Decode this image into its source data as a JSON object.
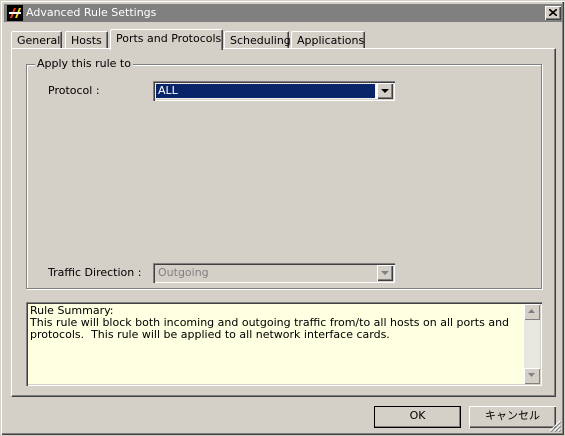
{
  "window": {
    "title": "Advanced Rule Settings",
    "icon": "firewall-app-icon",
    "close_icon": "close-icon"
  },
  "tabs": [
    {
      "label": "General",
      "active": false
    },
    {
      "label": "Hosts",
      "active": false
    },
    {
      "label": "Ports and Protocols",
      "active": true
    },
    {
      "label": "Scheduling",
      "active": false
    },
    {
      "label": "Applications",
      "active": false
    }
  ],
  "group": {
    "legend": "Apply this rule to",
    "protocol": {
      "label": "Protocol :",
      "value": "ALL"
    },
    "direction": {
      "label": "Traffic Direction :",
      "value": "Outgoing",
      "disabled": true
    }
  },
  "summary": {
    "text": "Rule Summary:\nThis rule will block both incoming and outgoing traffic from/to all hosts on all ports and\nprotocols.  This rule will be applied to all network interface cards."
  },
  "buttons": {
    "ok": "OK",
    "cancel": "キャンセル"
  },
  "colors": {
    "face": "#d4d0c8",
    "titlebar_inactive": "#808080",
    "selection": "#0a246a",
    "summary_bg": "#ffffe1"
  }
}
